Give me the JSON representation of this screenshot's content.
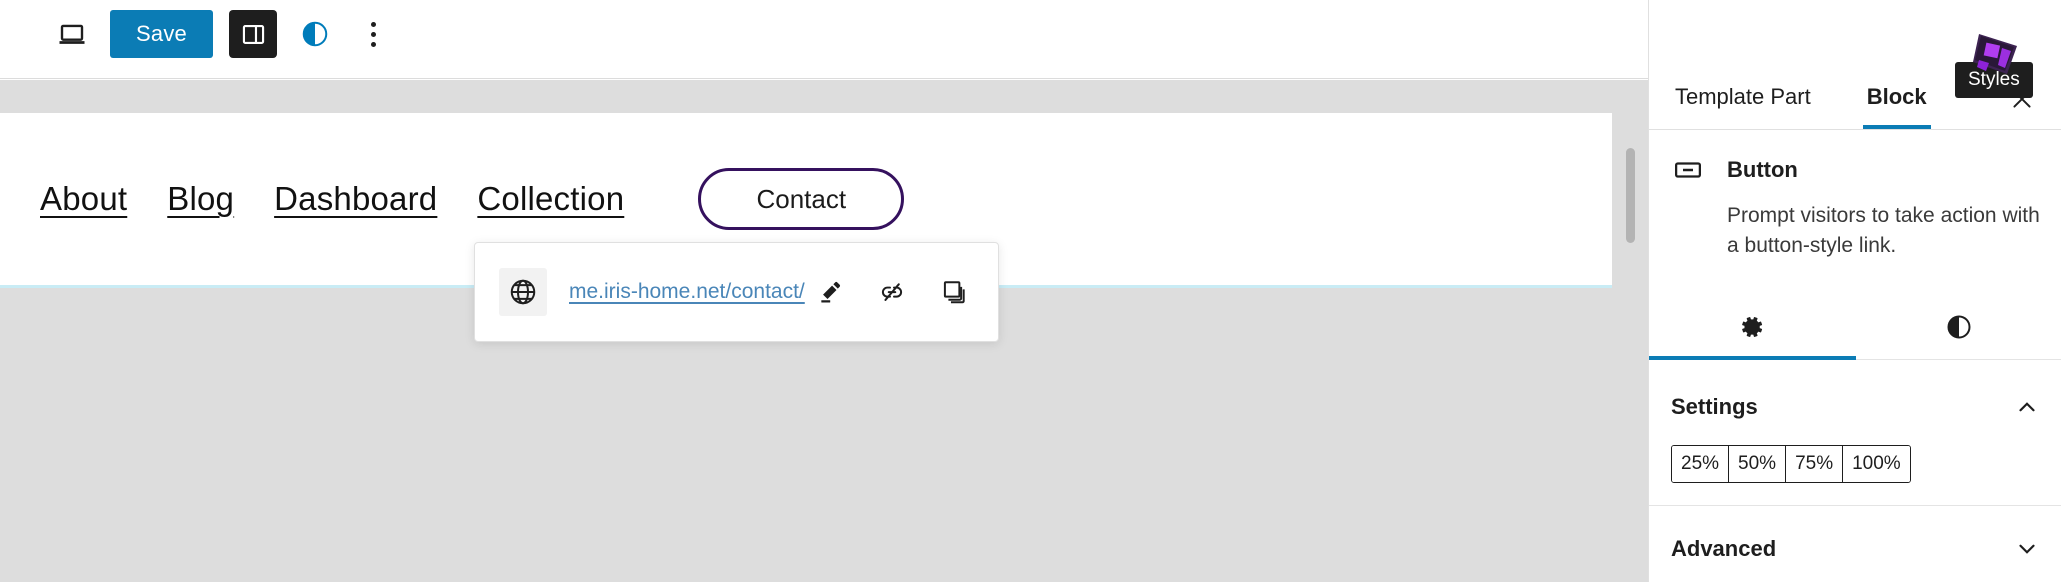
{
  "editor": {
    "nav": {
      "links": [
        {
          "label": "About"
        },
        {
          "label": "Blog"
        },
        {
          "label": "Dashboard"
        },
        {
          "label": "Collection"
        }
      ],
      "contact_button": {
        "label": "Contact",
        "border_color": "#35115e"
      }
    },
    "link_popover": {
      "icon": "globe-icon",
      "url": "me.iris-home.net/contact/",
      "actions": [
        {
          "icon": "pencil-edit-icon",
          "name": "edit-link"
        },
        {
          "icon": "unlink-icon",
          "name": "remove-link"
        },
        {
          "icon": "copy-icon",
          "name": "copy-link"
        }
      ]
    }
  },
  "toolbar": {
    "preview_icon": "laptop-icon",
    "save_label": "Save",
    "sidebar_toggle_icon": "sidebar-panel-icon",
    "styles_icon": "half-circle-contrast-icon",
    "options_icon": "kebab-menu-icon",
    "tooltip": "Styles",
    "save_color": "#0b7cb5"
  },
  "sidebar": {
    "tabs": [
      {
        "label": "Template Part",
        "active": false
      },
      {
        "label": "Block",
        "active": true
      }
    ],
    "close_icon": "close-icon",
    "block": {
      "icon": "button-block-icon",
      "title": "Button",
      "description": "Prompt visitors to take action with a button-style link."
    },
    "icon_tabs": [
      {
        "icon": "gear-icon",
        "name": "tab-settings",
        "active": true
      },
      {
        "icon": "contrast-icon",
        "name": "tab-styles",
        "active": false
      }
    ],
    "settings": {
      "title": "Settings",
      "chevron": "chevron-up-icon",
      "width_options": [
        {
          "label": "25%",
          "selected": false
        },
        {
          "label": "50%",
          "selected": false
        },
        {
          "label": "75%",
          "selected": false
        },
        {
          "label": "100%",
          "selected": false
        }
      ]
    },
    "advanced": {
      "title": "Advanced",
      "chevron": "chevron-down-icon"
    }
  }
}
